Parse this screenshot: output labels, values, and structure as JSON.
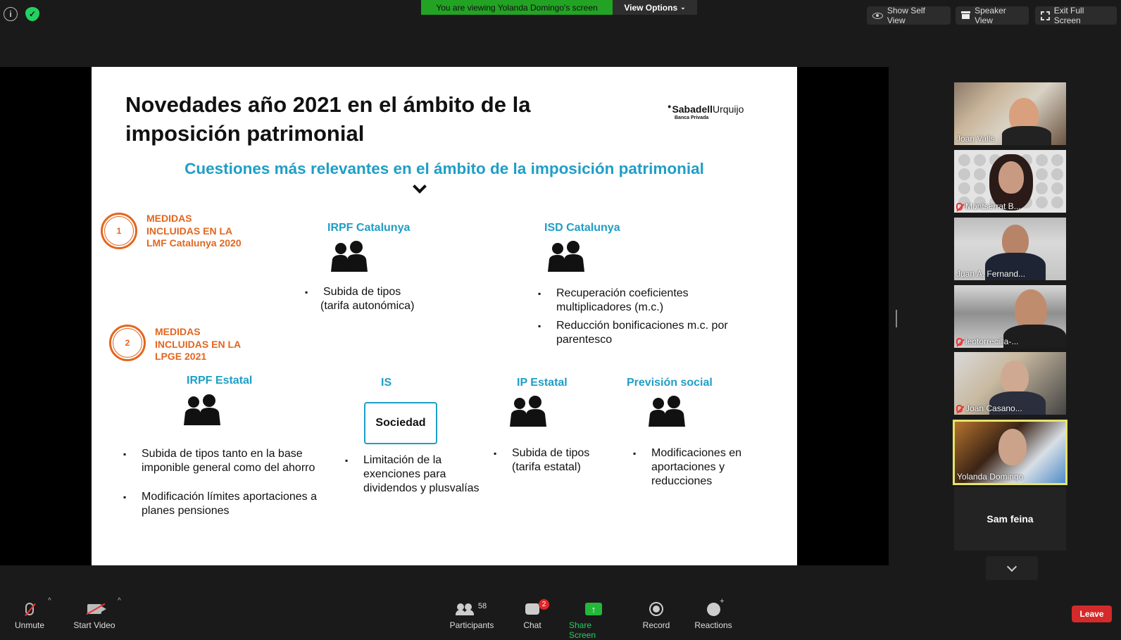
{
  "topbar": {
    "viewing_banner": "You are viewing Yolanda Domingo's screen",
    "view_options": "View Options",
    "show_self_view": "Show Self View",
    "speaker_view": "Speaker View",
    "exit_full_screen": "Exit Full Screen"
  },
  "slide": {
    "title_line1": "Novedades año 2021 en el ámbito de la",
    "title_line2": "imposición patrimonial",
    "logo_main_bold": "Sabadell",
    "logo_main": "Urquijo",
    "logo_sub": "Banca Privada",
    "subtitle": "Cuestiones más relevantes en el ámbito de la imposición patrimonial",
    "medidas1": {
      "num": "1",
      "line1": "MEDIDAS",
      "line2": "INCLUIDAS EN LA",
      "line3": "LMF Catalunya 2020"
    },
    "medidas2": {
      "num": "2",
      "line1": "MEDIDAS",
      "line2": "INCLUIDAS EN LA",
      "line3": "LPGE 2021"
    },
    "irpf_cat": {
      "title": "IRPF Catalunya",
      "b1a": "Subida de tipos",
      "b1b": "(tarifa autonómica)"
    },
    "isd_cat": {
      "title": "ISD Catalunya",
      "b1a": "Recuperación coeficientes",
      "b1b": "multiplicadores (m.c.)",
      "b2a": "Reducción bonificaciones m.c. por",
      "b2b": "parentesco"
    },
    "irpf_est": {
      "title": "IRPF Estatal",
      "b1a": "Subida de tipos tanto en la base",
      "b1b": "imponible general como del ahorro",
      "b2a": "Modificación límites aportaciones a",
      "b2b": "planes pensiones"
    },
    "is": {
      "title": "IS",
      "box": "Sociedad",
      "b1a": "Limitación de la",
      "b1b": "exenciones para",
      "b1c": "dividendos y plusvalías"
    },
    "ip_est": {
      "title": "IP Estatal",
      "b1a": "Subida de tipos",
      "b1b": "(tarifa estatal)"
    },
    "prevision": {
      "title": "Previsión social",
      "b1a": "Modificaciones en",
      "b1b": "aportaciones y",
      "b1c": "reducciones"
    }
  },
  "participants_panel": {
    "tiles": [
      {
        "name": "Joan Valls"
      },
      {
        "name": "Montserrat B..."
      },
      {
        "name": "Juan A. Fernand..."
      },
      {
        "name": "leotorrecilla-..."
      },
      {
        "name": "Joan Casano..."
      },
      {
        "name": "Yolanda Domingo"
      }
    ],
    "no_video_name": "Sam feina"
  },
  "toolbar": {
    "unmute": "Unmute",
    "start_video": "Start Video",
    "participants": "Participants",
    "participants_count": "58",
    "chat": "Chat",
    "chat_badge": "2",
    "share_screen": "Share Screen",
    "record": "Record",
    "reactions": "Reactions",
    "leave": "Leave"
  },
  "colors": {
    "accent_blue": "#1f9ec6",
    "accent_orange": "#e2661f",
    "green": "#23a324",
    "leave_red": "#d42a2a"
  }
}
